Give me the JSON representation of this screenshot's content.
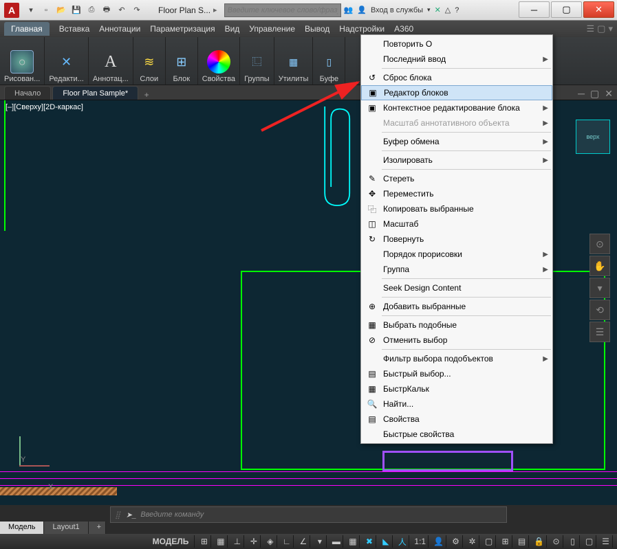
{
  "titlebar": {
    "doc_title": "Floor Plan S...",
    "search_placeholder": "Введите ключевое слово/фразу",
    "login_label": "Вход в службы"
  },
  "menubar": {
    "items": [
      "Главная",
      "Вставка",
      "Аннотации",
      "Параметризация",
      "Вид",
      "Управление",
      "Вывод",
      "Надстройки",
      "A360"
    ]
  },
  "ribbon": {
    "panels": [
      {
        "label": "Рисован...",
        "color": "#4a6d8a"
      },
      {
        "label": "Редакти...",
        "color": "#4d4d4d"
      },
      {
        "label": "Аннотац...",
        "color": "#555",
        "text": "А"
      },
      {
        "label": "Слои",
        "color": "#5a6d5a"
      },
      {
        "label": "Блок",
        "color": "#5a5a6d"
      },
      {
        "label": "Свойства",
        "color": "conic-gradient(red,yellow,lime,cyan,blue,magenta,red)"
      },
      {
        "label": "Группы",
        "color": "#555"
      },
      {
        "label": "Утилиты",
        "color": "#555"
      },
      {
        "label": "Буфе",
        "color": "#555"
      }
    ]
  },
  "filetabs": {
    "start": "Начало",
    "active": "Floor Plan Sample*"
  },
  "canvas": {
    "view_label": "[–][Сверху][2D-каркас]"
  },
  "context_menu": {
    "items": [
      {
        "label": "Повторить О",
        "icon": ""
      },
      {
        "label": "Последний ввод",
        "icon": "",
        "arrow": true
      },
      {
        "sep": true
      },
      {
        "label": "Сброс блока",
        "icon": "↺"
      },
      {
        "label": "Редактор блоков",
        "icon": "▣",
        "hl": true
      },
      {
        "label": "Контекстное редактирование блока",
        "icon": "▣",
        "arrow": true
      },
      {
        "label": "Масштаб аннотативного объекта",
        "icon": "",
        "disabled": true,
        "arrow": true
      },
      {
        "sep": true
      },
      {
        "label": "Буфер обмена",
        "icon": "",
        "arrow": true
      },
      {
        "sep": true
      },
      {
        "label": "Изолировать",
        "icon": "",
        "arrow": true
      },
      {
        "sep": true
      },
      {
        "label": "Стереть",
        "icon": "✎"
      },
      {
        "label": "Переместить",
        "icon": "✥"
      },
      {
        "label": "Копировать выбранные",
        "icon": "⿻"
      },
      {
        "label": "Масштаб",
        "icon": "◫"
      },
      {
        "label": "Повернуть",
        "icon": "↻"
      },
      {
        "label": "Порядок прорисовки",
        "icon": "",
        "arrow": true
      },
      {
        "label": "Группа",
        "icon": "",
        "arrow": true
      },
      {
        "sep": true
      },
      {
        "label": "Seek Design Content",
        "icon": ""
      },
      {
        "sep": true
      },
      {
        "label": "Добавить выбранные",
        "icon": "⊕"
      },
      {
        "sep": true
      },
      {
        "label": "Выбрать подобные",
        "icon": "▦"
      },
      {
        "label": "Отменить выбор",
        "icon": "⊘"
      },
      {
        "sep": true
      },
      {
        "label": "Фильтр выбора подобъектов",
        "icon": "",
        "arrow": true
      },
      {
        "label": "Быстрый выбор...",
        "icon": "▤"
      },
      {
        "label": "БыстрКальк",
        "icon": "▦"
      },
      {
        "label": "Найти...",
        "icon": "🔍"
      },
      {
        "label": "Свойства",
        "icon": "▤"
      },
      {
        "label": "Быстрые свойства",
        "icon": ""
      }
    ]
  },
  "cmdline": {
    "placeholder": "Введите команду"
  },
  "bottom_tabs": {
    "model": "Модель",
    "layout": "Layout1"
  },
  "statusbar": {
    "model_label": "МОДЕЛЬ",
    "scale": "1:1"
  },
  "ucs": {
    "y": "Y",
    "x": "X"
  }
}
